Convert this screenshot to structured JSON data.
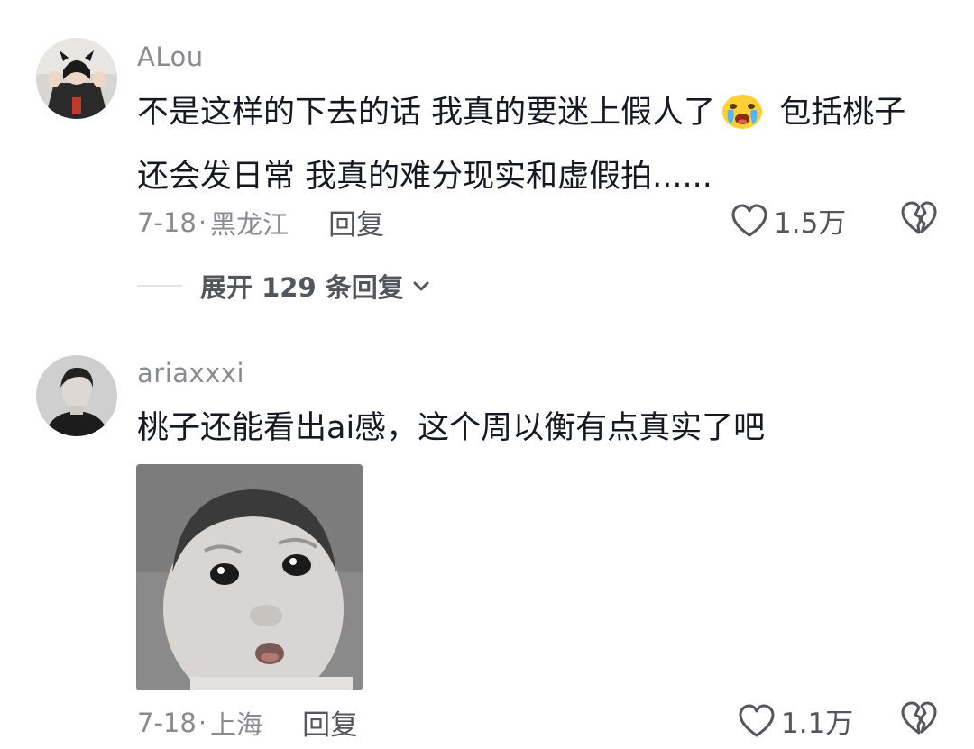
{
  "comments": [
    {
      "username": "ALou",
      "text_part1": "不是这样的下去的话 我真的要迷上假人了",
      "emoji": "crying-face-emoji",
      "text_part2": " 包括桃子",
      "text_line2": "还会发日常 我真的难分现实和虚假拍......",
      "date": "7-18",
      "location_sep": "·",
      "location": "黑龙江",
      "reply_label": "回复",
      "likes": "1.5万",
      "expand_label": "展开 129 条回复"
    },
    {
      "username": "ariaxxxi",
      "text": "桃子还能看出ai感，这个周以衡有点真实了吧",
      "date": "7-18",
      "location_sep": "·",
      "location": "上海",
      "reply_label": "回复",
      "likes": "1.1万"
    }
  ],
  "colors": {
    "primary_text": "#161823",
    "secondary_text": "#8a8b91",
    "action_text": "#55565c"
  }
}
